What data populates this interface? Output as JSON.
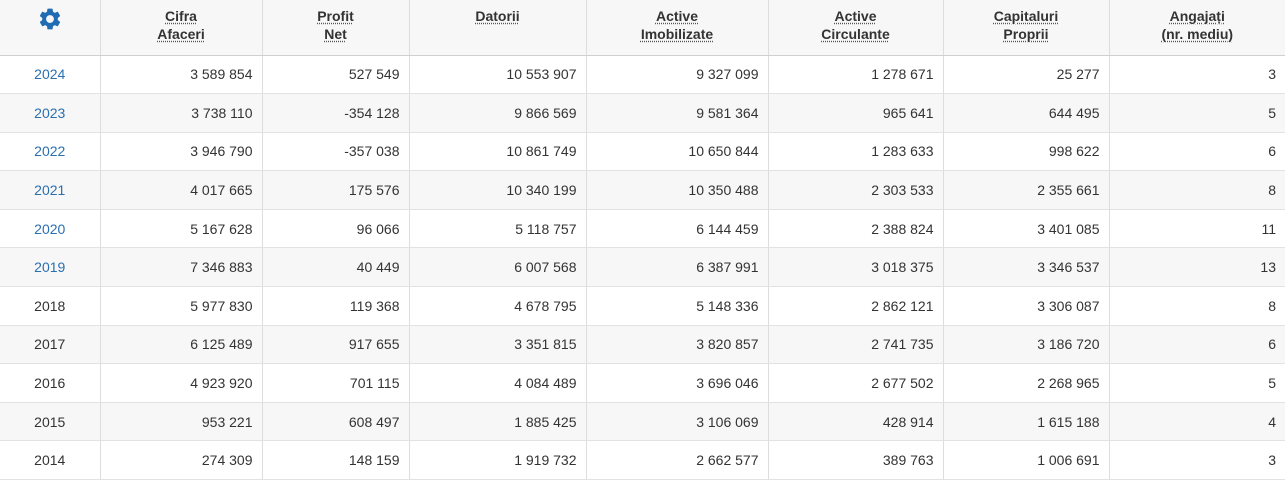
{
  "colors": {
    "accent": "#2a6fb0",
    "header_bg": "#f7f7f7",
    "row_alt_bg": "#f7f7f7",
    "border": "#dddddd"
  },
  "settings_icon": "gear-icon",
  "headers": [
    {
      "line1": "Cifra",
      "line2": "Afaceri"
    },
    {
      "line1": "Profit",
      "line2": "Net"
    },
    {
      "line1": "Datorii",
      "line2": ""
    },
    {
      "line1": "Active",
      "line2": "Imobilizate"
    },
    {
      "line1": "Active",
      "line2": "Circulante"
    },
    {
      "line1": "Capitaluri",
      "line2": "Proprii"
    },
    {
      "line1": "Angajați",
      "line2": "(nr. mediu)"
    }
  ],
  "rows": [
    {
      "year": "2024",
      "linked": true,
      "cifra_afaceri": "3 589 854",
      "profit_net": "527 549",
      "datorii": "10 553 907",
      "active_imobilizate": "9 327 099",
      "active_circulante": "1 278 671",
      "capitaluri_proprii": "25 277",
      "angajati": "3"
    },
    {
      "year": "2023",
      "linked": true,
      "cifra_afaceri": "3 738 110",
      "profit_net": "-354 128",
      "datorii": "9 866 569",
      "active_imobilizate": "9 581 364",
      "active_circulante": "965 641",
      "capitaluri_proprii": "644 495",
      "angajati": "5"
    },
    {
      "year": "2022",
      "linked": true,
      "cifra_afaceri": "3 946 790",
      "profit_net": "-357 038",
      "datorii": "10 861 749",
      "active_imobilizate": "10 650 844",
      "active_circulante": "1 283 633",
      "capitaluri_proprii": "998 622",
      "angajati": "6"
    },
    {
      "year": "2021",
      "linked": true,
      "cifra_afaceri": "4 017 665",
      "profit_net": "175 576",
      "datorii": "10 340 199",
      "active_imobilizate": "10 350 488",
      "active_circulante": "2 303 533",
      "capitaluri_proprii": "2 355 661",
      "angajati": "8"
    },
    {
      "year": "2020",
      "linked": true,
      "cifra_afaceri": "5 167 628",
      "profit_net": "96 066",
      "datorii": "5 118 757",
      "active_imobilizate": "6 144 459",
      "active_circulante": "2 388 824",
      "capitaluri_proprii": "3 401 085",
      "angajati": "11"
    },
    {
      "year": "2019",
      "linked": true,
      "cifra_afaceri": "7 346 883",
      "profit_net": "40 449",
      "datorii": "6 007 568",
      "active_imobilizate": "6 387 991",
      "active_circulante": "3 018 375",
      "capitaluri_proprii": "3 346 537",
      "angajati": "13"
    },
    {
      "year": "2018",
      "linked": false,
      "cifra_afaceri": "5 977 830",
      "profit_net": "119 368",
      "datorii": "4 678 795",
      "active_imobilizate": "5 148 336",
      "active_circulante": "2 862 121",
      "capitaluri_proprii": "3 306 087",
      "angajati": "8"
    },
    {
      "year": "2017",
      "linked": false,
      "cifra_afaceri": "6 125 489",
      "profit_net": "917 655",
      "datorii": "3 351 815",
      "active_imobilizate": "3 820 857",
      "active_circulante": "2 741 735",
      "capitaluri_proprii": "3 186 720",
      "angajati": "6"
    },
    {
      "year": "2016",
      "linked": false,
      "cifra_afaceri": "4 923 920",
      "profit_net": "701 115",
      "datorii": "4 084 489",
      "active_imobilizate": "3 696 046",
      "active_circulante": "2 677 502",
      "capitaluri_proprii": "2 268 965",
      "angajati": "5"
    },
    {
      "year": "2015",
      "linked": false,
      "cifra_afaceri": "953 221",
      "profit_net": "608 497",
      "datorii": "1 885 425",
      "active_imobilizate": "3 106 069",
      "active_circulante": "428 914",
      "capitaluri_proprii": "1 615 188",
      "angajati": "4"
    },
    {
      "year": "2014",
      "linked": false,
      "cifra_afaceri": "274 309",
      "profit_net": "148 159",
      "datorii": "1 919 732",
      "active_imobilizate": "2 662 577",
      "active_circulante": "389 763",
      "capitaluri_proprii": "1 006 691",
      "angajati": "3"
    }
  ]
}
